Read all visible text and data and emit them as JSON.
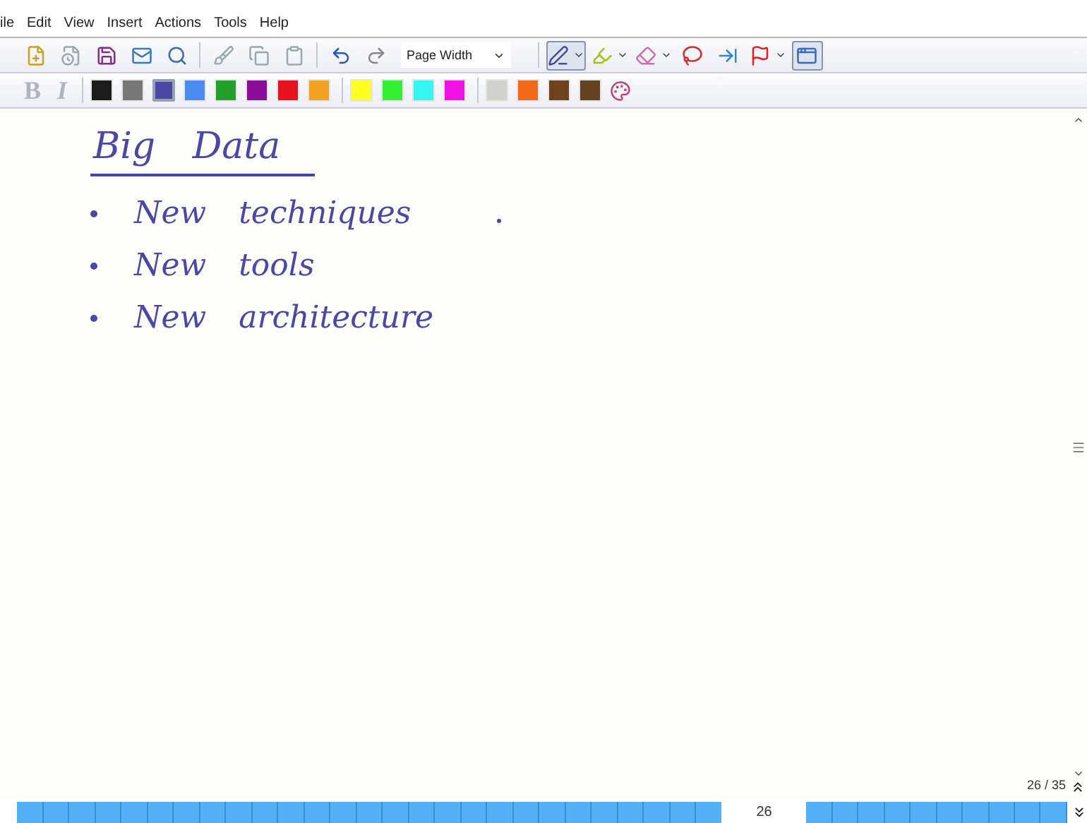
{
  "menu": [
    "ile",
    "Edit",
    "View",
    "Insert",
    "Actions",
    "Tools",
    "Help"
  ],
  "toolbar": [
    {
      "kind": "new-note",
      "selected": false
    },
    {
      "kind": "new-page",
      "selected": false
    },
    {
      "kind": "save",
      "selected": false
    },
    {
      "kind": "send",
      "selected": false
    },
    {
      "kind": "find",
      "selected": false
    },
    {
      "kind": "sep"
    },
    {
      "kind": "format-painter",
      "selected": false
    },
    {
      "kind": "copy",
      "selected": false
    },
    {
      "kind": "paste",
      "selected": false
    },
    {
      "kind": "sep"
    },
    {
      "kind": "undo",
      "selected": false
    },
    {
      "kind": "redo",
      "selected": false
    }
  ],
  "zoom": {
    "value": "Page Width"
  },
  "tools": [
    {
      "kind": "pen",
      "selected": true,
      "dropdown": true
    },
    {
      "kind": "highlighter",
      "selected": false,
      "dropdown": true
    },
    {
      "kind": "eraser",
      "selected": false,
      "dropdown": true
    },
    {
      "kind": "lasso",
      "selected": false,
      "dropdown": false
    },
    {
      "kind": "insert-space",
      "selected": false,
      "dropdown": false
    },
    {
      "kind": "flag",
      "selected": false,
      "dropdown": true
    },
    {
      "kind": "full-screen",
      "selected": true,
      "dropdown": false
    }
  ],
  "format": [
    {
      "label": "B",
      "disabled": true,
      "kind": "bold"
    },
    {
      "label": "I",
      "disabled": true,
      "kind": "italic"
    }
  ],
  "palette": [
    {
      "color": "#1c1c1c",
      "selected": false
    },
    {
      "color": "#787878",
      "selected": false
    },
    {
      "color": "#4a48a6",
      "selected": true
    },
    {
      "color": "#4a8cf0",
      "selected": false
    },
    {
      "color": "#22a02c",
      "selected": false
    },
    {
      "color": "#8a0c98",
      "selected": false
    },
    {
      "color": "#e8121c",
      "selected": false
    },
    {
      "color": "#f5a222",
      "selected": false
    },
    {
      "color": "#ffff22",
      "selected": false
    },
    {
      "color": "#34f034",
      "selected": false
    },
    {
      "color": "#34f8f0",
      "selected": false
    },
    {
      "color": "#f012e0",
      "selected": false
    },
    {
      "color": "#d2d2cc",
      "selected": false
    },
    {
      "color": "#f06a1a",
      "selected": false
    },
    {
      "color": "#70421c",
      "selected": false
    },
    {
      "color": "#62421f",
      "selected": false
    }
  ],
  "note": {
    "heading": "Big Data",
    "bullets": [
      "New techniques",
      "New tools",
      "New architecture"
    ]
  },
  "page_indicator": "26 / 35",
  "page_strip": {
    "current": "26"
  }
}
